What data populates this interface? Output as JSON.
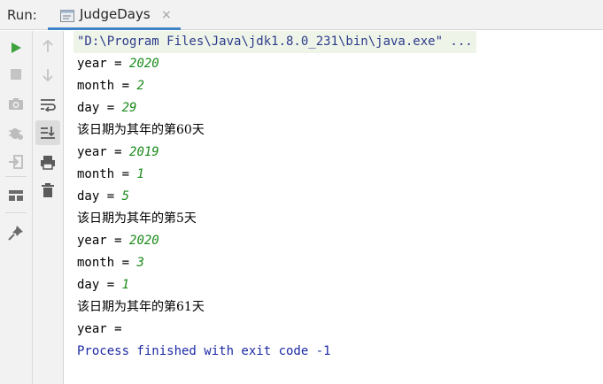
{
  "header": {
    "run_label": "Run:",
    "tab_label": "JudgeDays",
    "tab_close": "×"
  },
  "console": {
    "command": "\"D:\\Program Files\\Java\\jdk1.8.0_231\\bin\\java.exe\" ...",
    "lines": [
      {
        "text": "year = ",
        "value": "2020"
      },
      {
        "text": "month = ",
        "value": "2"
      },
      {
        "text": "day = ",
        "value": "29"
      },
      {
        "text": "该日期为其年的第60天",
        "value": ""
      },
      {
        "text": "year = ",
        "value": "2019"
      },
      {
        "text": "month = ",
        "value": "1"
      },
      {
        "text": "day = ",
        "value": "5"
      },
      {
        "text": "该日期为其年的第5天",
        "value": ""
      },
      {
        "text": "year = ",
        "value": "2020"
      },
      {
        "text": "month = ",
        "value": "3"
      },
      {
        "text": "day = ",
        "value": "1"
      },
      {
        "text": "该日期为其年的第61天",
        "value": ""
      },
      {
        "text": "year = ",
        "value": ""
      }
    ],
    "finish": "Process finished with exit code -1"
  },
  "colors": {
    "run_green": "#3ea33e",
    "value_green": "#1a8a1a",
    "process_blue": "#1d2aa5",
    "tab_underline": "#4083c9"
  },
  "icons": {
    "left_toolbar": [
      "run-icon",
      "stop-icon",
      "camera-icon",
      "debug-icon",
      "exit-icon",
      "layout-icon",
      "pin-icon"
    ],
    "right_toolbar": [
      "up-arrow-icon",
      "down-arrow-icon",
      "soft-wrap-icon",
      "scroll-to-end-icon",
      "print-icon",
      "trash-icon"
    ]
  }
}
